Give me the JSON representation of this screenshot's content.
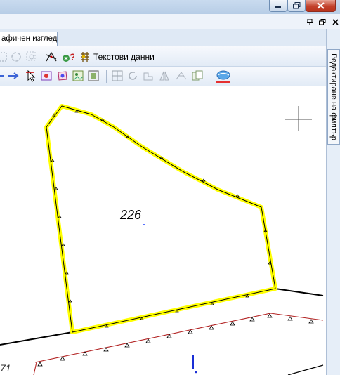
{
  "tabs": {
    "graphic_view": "афичен изглед"
  },
  "toolbar": {
    "text_data_label": "Текстови данни"
  },
  "side_panel": {
    "filter_tab_label": "Редактиране на филтър"
  },
  "map": {
    "parcel_number": "226",
    "partial_parcel_number": "71",
    "parcel_outline_color": "#ffff00",
    "boundary_color": "#000000",
    "neighbor_boundary_color": "#b22222"
  },
  "icons": {
    "window": [
      "minimize-icon",
      "restore-icon",
      "close-icon"
    ],
    "mdi": [
      "pin-icon",
      "restore-icon",
      "close-icon"
    ]
  }
}
